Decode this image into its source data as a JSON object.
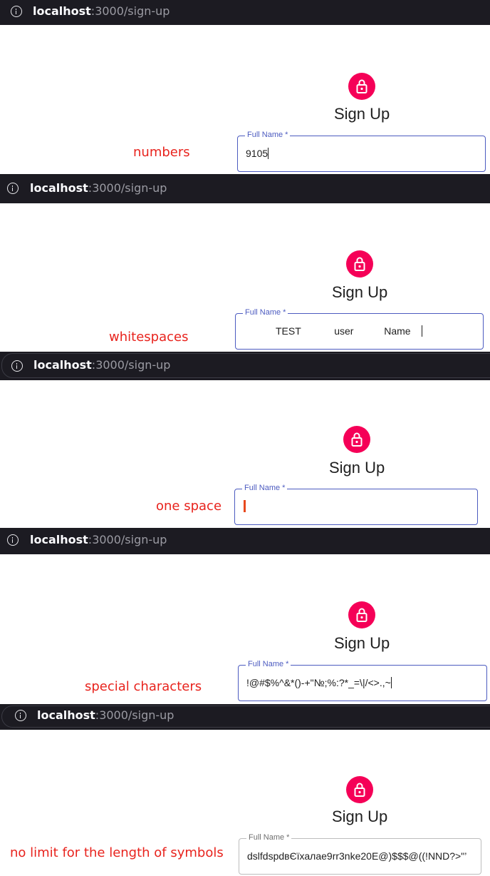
{
  "browser": {
    "host": "localhost",
    "path": ":3000/sign-up"
  },
  "form": {
    "title": "Sign Up",
    "field_label": "Full Name *"
  },
  "cases": [
    {
      "label": "numbers",
      "value": "9105"
    },
    {
      "label": "whitespaces",
      "value": "TEST            user           Name"
    },
    {
      "label": "one space",
      "value": ""
    },
    {
      "label": "special characters",
      "value": "!@#$%^&*()-+\"№;%:?*_=\\|/<>.,~"
    },
    {
      "label": "no limit for the length of symbols",
      "value": "dslfdspdвЄїхалае9rr3nke20E@)$$$@((!NND?>\"’"
    }
  ],
  "colors": {
    "accent": "#f50057",
    "field_border": "#4c5bc0",
    "annotation": "#e8231d",
    "url_bar": "#1c1b22"
  },
  "icons": {
    "url_info": "info-icon",
    "avatar": "lock-icon"
  }
}
